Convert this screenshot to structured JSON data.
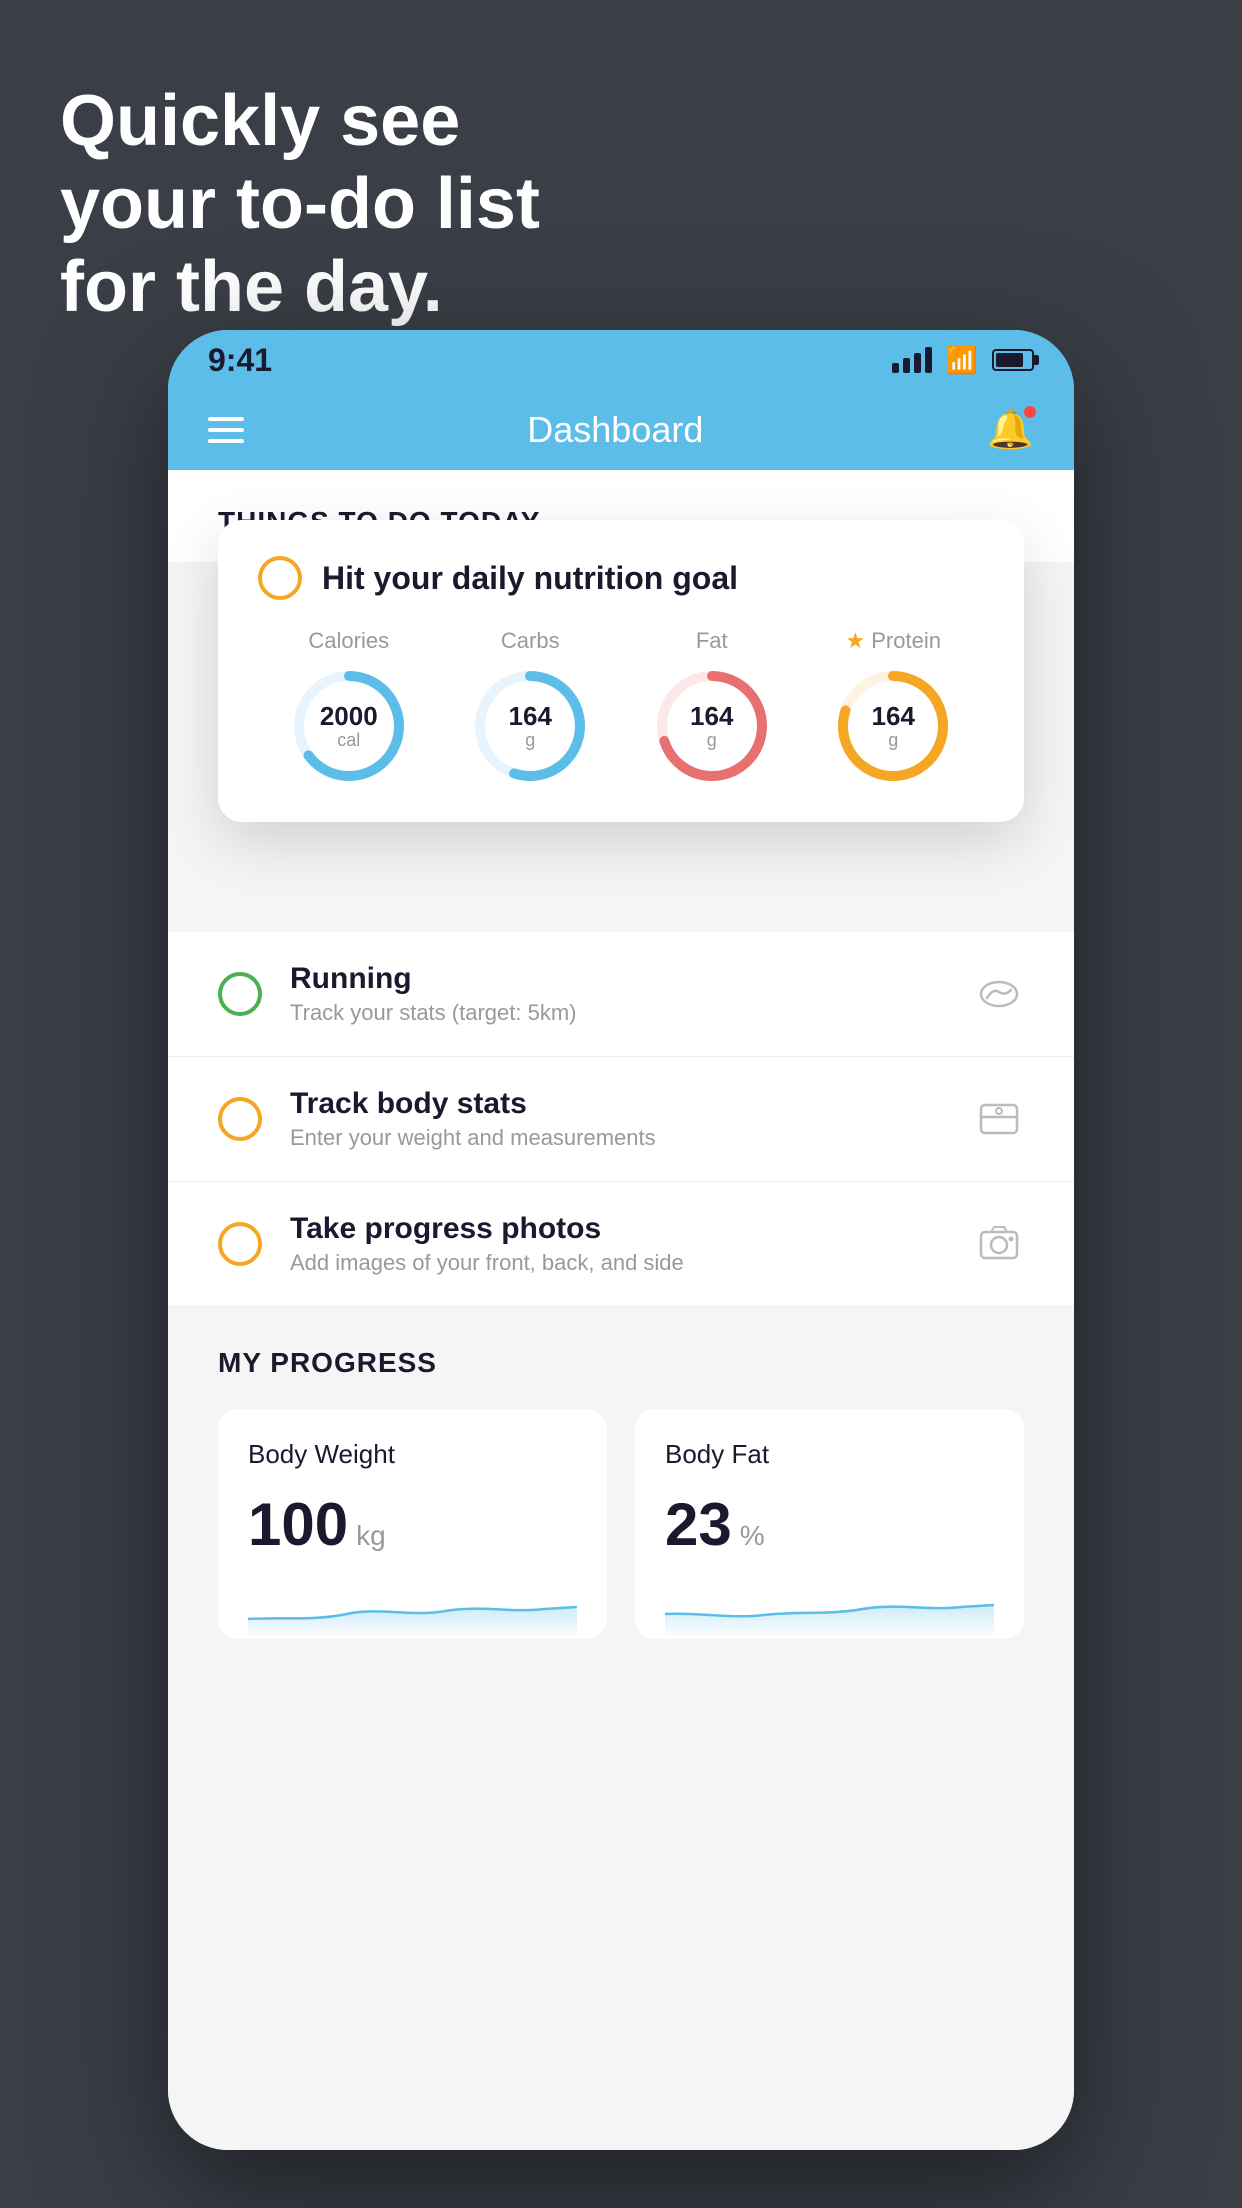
{
  "headline": {
    "line1": "Quickly see",
    "line2": "your to-do list",
    "line3": "for the day."
  },
  "status_bar": {
    "time": "9:41"
  },
  "nav": {
    "title": "Dashboard"
  },
  "things_section": {
    "title": "THINGS TO DO TODAY"
  },
  "floating_card": {
    "label": "Hit your daily nutrition goal",
    "nutrition": [
      {
        "label": "Calories",
        "value": "2000",
        "unit": "cal",
        "color": "#5bbde8",
        "percent": 65
      },
      {
        "label": "Carbs",
        "value": "164",
        "unit": "g",
        "color": "#5bbde8",
        "percent": 55
      },
      {
        "label": "Fat",
        "value": "164",
        "unit": "g",
        "color": "#e87070",
        "percent": 70
      },
      {
        "label": "Protein",
        "value": "164",
        "unit": "g",
        "color": "#f5a623",
        "percent": 80,
        "starred": true
      }
    ]
  },
  "todo_items": [
    {
      "title": "Running",
      "subtitle": "Track your stats (target: 5km)",
      "circle_color": "green",
      "icon": "running"
    },
    {
      "title": "Track body stats",
      "subtitle": "Enter your weight and measurements",
      "circle_color": "yellow",
      "icon": "scale"
    },
    {
      "title": "Take progress photos",
      "subtitle": "Add images of your front, back, and side",
      "circle_color": "yellow",
      "icon": "photo"
    }
  ],
  "progress_section": {
    "title": "MY PROGRESS",
    "cards": [
      {
        "title": "Body Weight",
        "value": "100",
        "unit": "kg"
      },
      {
        "title": "Body Fat",
        "value": "23",
        "unit": "%"
      }
    ]
  }
}
